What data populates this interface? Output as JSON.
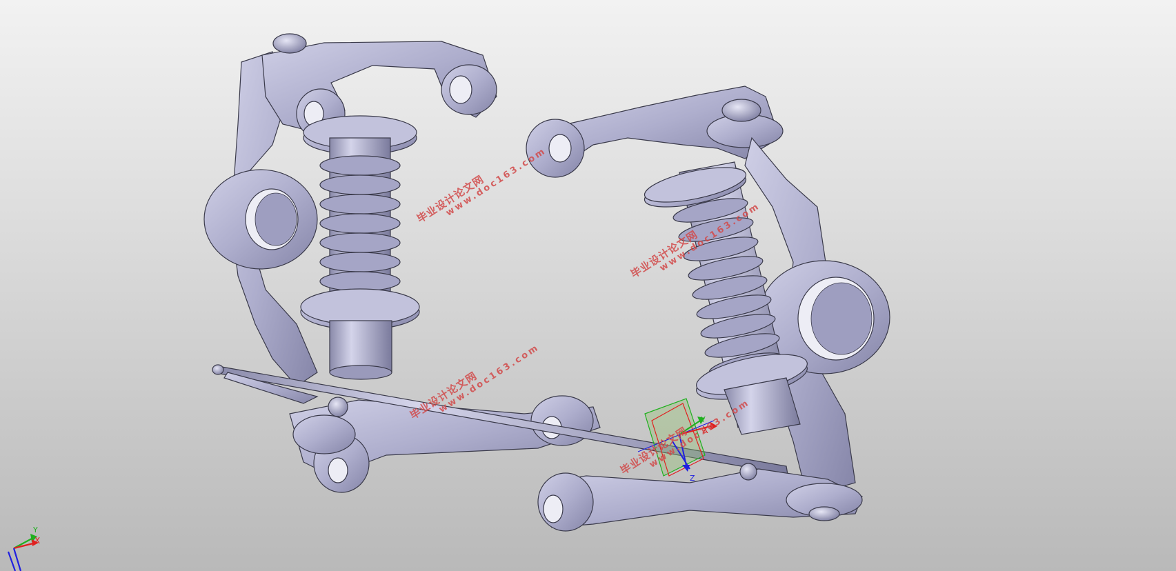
{
  "viewport": {
    "background_top": "#f2f2f2",
    "background_bottom": "#b9b9b9",
    "part_color": "#b4b4d2",
    "part_edge_color": "#3a3a4a"
  },
  "watermark": {
    "title": "毕业设计论文网",
    "url": "www.doc163.com",
    "color": "#d24a4a"
  },
  "triad": {
    "x_label": "X",
    "y_label": "Y",
    "z_label": "Z",
    "x_color": "#e02020",
    "y_color": "#20b020",
    "z_color": "#2020e0"
  }
}
